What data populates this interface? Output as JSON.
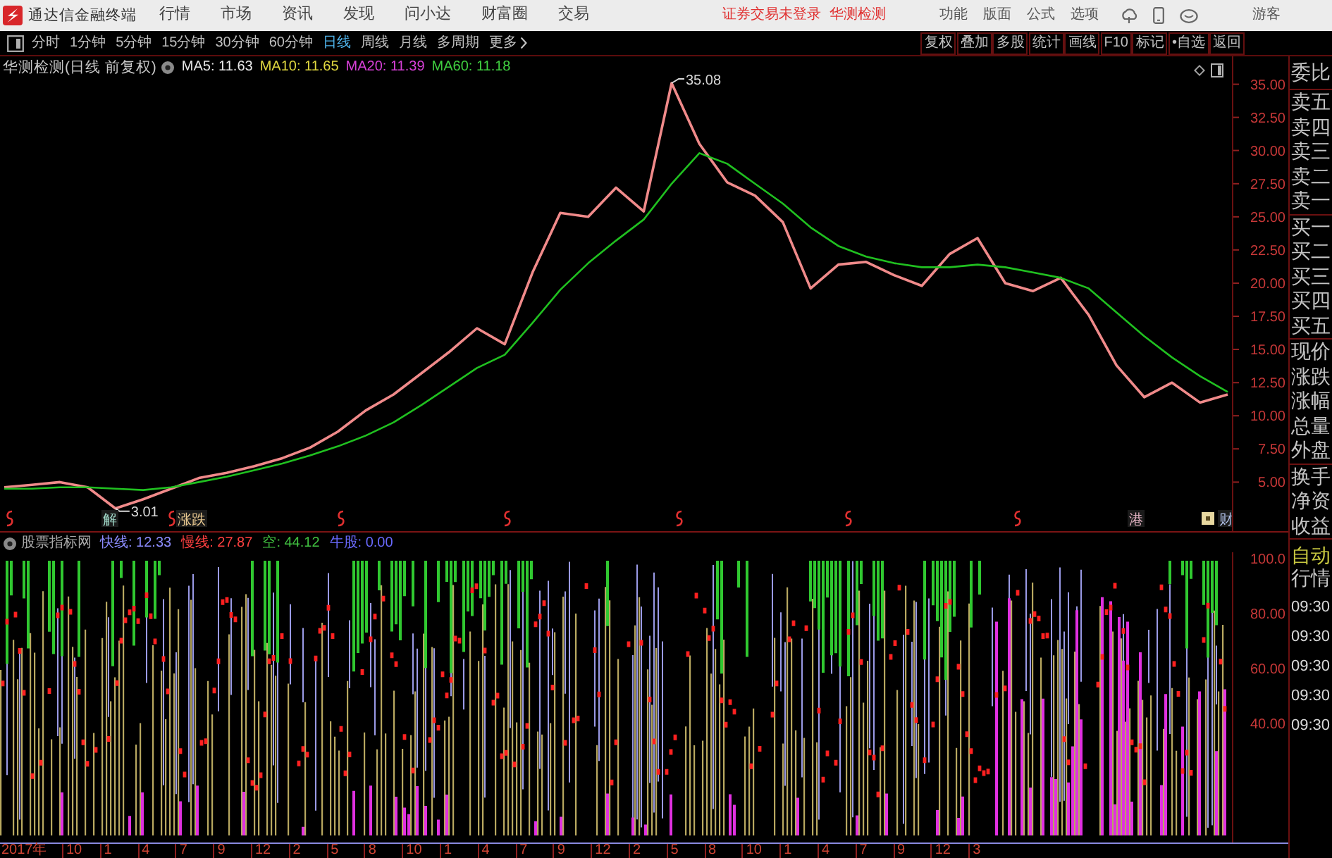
{
  "title_bar": {
    "app_title": "通达信金融终端",
    "menu": [
      "行情",
      "市场",
      "资讯",
      "发现",
      "问小达",
      "财富圈",
      "交易"
    ],
    "notices": [
      "证券交易未登录",
      "华测检测"
    ],
    "tools": [
      "功能",
      "版面",
      "公式",
      "选项"
    ],
    "user": "游客"
  },
  "period_bar": {
    "periods": [
      {
        "label": "分时",
        "selected": false
      },
      {
        "label": "1分钟",
        "selected": false
      },
      {
        "label": "5分钟",
        "selected": false
      },
      {
        "label": "15分钟",
        "selected": false
      },
      {
        "label": "30分钟",
        "selected": false
      },
      {
        "label": "60分钟",
        "selected": false
      },
      {
        "label": "日线",
        "selected": true
      },
      {
        "label": "周线",
        "selected": false
      },
      {
        "label": "月线",
        "selected": false
      },
      {
        "label": "多周期",
        "selected": false
      }
    ],
    "more": "更多",
    "actions": [
      "复权",
      "叠加",
      "多股",
      "统计",
      "画线",
      "F10",
      "标记",
      "•自选",
      "返回"
    ]
  },
  "price_chart": {
    "title": "华测检测(日线 前复权)",
    "ma_legend": [
      {
        "label": "MA5: 11.63",
        "color": "#e8e8e8"
      },
      {
        "label": "MA10: 11.65",
        "color": "#e0d840"
      },
      {
        "label": "MA20: 11.39",
        "color": "#d840d8"
      },
      {
        "label": "MA60: 11.18",
        "color": "#40d040"
      }
    ],
    "chart_data": {
      "type": "line",
      "ylim": [
        1.3,
        37.1
      ],
      "yticks": [
        {
          "value": 35,
          "label": "35.00"
        },
        {
          "value": 32.5,
          "label": "32.50"
        },
        {
          "value": 30,
          "label": "30.00"
        },
        {
          "value": 27.5,
          "label": "27.50"
        },
        {
          "value": 25,
          "label": "25.00"
        },
        {
          "value": 22.5,
          "label": "22.50"
        },
        {
          "value": 20,
          "label": "20.00"
        },
        {
          "value": 17.5,
          "label": "17.50"
        },
        {
          "value": 15,
          "label": "15.00"
        },
        {
          "value": 12.5,
          "label": "12.50"
        },
        {
          "value": 10,
          "label": "10.00"
        },
        {
          "value": 7.5,
          "label": "7.50"
        },
        {
          "value": 5,
          "label": "5.00"
        }
      ],
      "series": [
        {
          "color": "#f08a8a",
          "values": [
            4.6,
            4.8,
            5.0,
            4.6,
            3.01,
            3.7,
            4.5,
            5.3,
            5.7,
            6.2,
            6.8,
            7.6,
            8.8,
            10.4,
            11.6,
            13.2,
            14.8,
            16.6,
            15.4,
            20.8,
            25.3,
            25.0,
            27.2,
            25.4,
            35.08,
            30.5,
            27.6,
            26.6,
            24.6,
            19.6,
            21.4,
            21.6,
            20.6,
            19.8,
            22.2,
            23.4,
            20.0,
            19.4,
            20.4,
            17.6,
            13.8,
            11.4,
            12.5,
            11.0,
            11.6
          ]
        },
        {
          "color": "#20c020",
          "values": [
            4.5,
            4.5,
            4.6,
            4.6,
            4.5,
            4.4,
            4.6,
            5.0,
            5.4,
            5.9,
            6.4,
            7.0,
            7.7,
            8.5,
            9.5,
            10.8,
            12.2,
            13.6,
            14.6,
            17.0,
            19.5,
            21.5,
            23.2,
            24.8,
            27.5,
            29.8,
            29.0,
            27.5,
            26.0,
            24.2,
            22.8,
            22.0,
            21.5,
            21.2,
            21.2,
            21.4,
            21.2,
            20.8,
            20.4,
            19.6,
            17.8,
            16.0,
            14.4,
            13.0,
            11.8
          ]
        }
      ]
    },
    "high_label": "35.08",
    "low_label": "3.01",
    "event_markers": [
      {
        "kind": "flag"
      },
      {
        "kind": "tag",
        "text": "解",
        "color": "#a0d8c8"
      },
      {
        "kind": "flag"
      },
      {
        "kind": "tag",
        "text": "涨跌",
        "color": "#e8c890"
      },
      {
        "kind": "flag"
      },
      {
        "kind": "flag"
      },
      {
        "kind": "flag"
      },
      {
        "kind": "flag"
      },
      {
        "kind": "flag"
      },
      {
        "kind": "tag",
        "text": "港",
        "color": "#e0b0c0"
      },
      {
        "kind": "box",
        "color": "#e8d8a0"
      },
      {
        "kind": "tag",
        "text": "财",
        "color": "#b0c0e8"
      }
    ]
  },
  "indicator": {
    "title": "股票指标网",
    "legend": [
      {
        "label": "快线: 12.33",
        "color": "#8c8cff"
      },
      {
        "label": "慢线: 27.87",
        "color": "#ff4040"
      },
      {
        "label": "空: 44.12",
        "color": "#40c040"
      },
      {
        "label": "牛股: 0.00",
        "color": "#6a6aff"
      }
    ],
    "axis_labels": [
      "100.0",
      "80.00",
      "60.00",
      "40.00"
    ]
  },
  "date_axis": [
    "2017年",
    "10",
    "1",
    "4",
    "7",
    "9",
    "12",
    "2",
    "5",
    "8",
    "10",
    "1",
    "4",
    "7",
    "9",
    "12",
    "2",
    "5",
    "8",
    "10",
    "1",
    "4",
    "7",
    "9",
    "12",
    "3"
  ],
  "quote_panel": {
    "groups": [
      [
        "委比"
      ],
      [
        "卖五",
        "卖四",
        "卖三",
        "卖二",
        "卖一"
      ],
      [
        "买一",
        "买二",
        "买三",
        "买四",
        "买五"
      ],
      [
        "现价",
        "涨跌",
        "涨幅",
        "总量",
        "外盘"
      ],
      [
        "换手",
        "净资",
        "收益"
      ]
    ],
    "modes": [
      {
        "label": "自动",
        "color": "#c8c840"
      },
      {
        "label": "行情",
        "color": "#c8c8c8"
      }
    ],
    "times": [
      "09:30",
      "09:30",
      "09:30",
      "09:30",
      "09:30"
    ]
  }
}
